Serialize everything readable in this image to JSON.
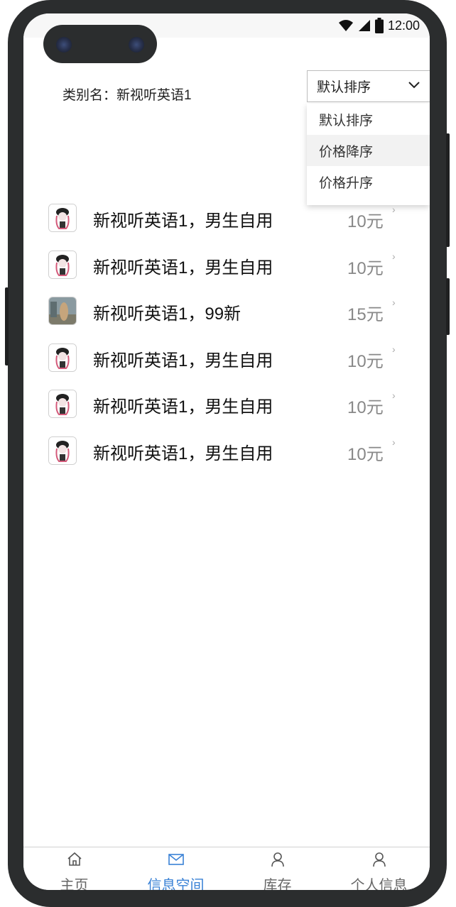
{
  "status_bar": {
    "time": "12:00"
  },
  "category": {
    "text": "类别名：新视听英语1"
  },
  "sort": {
    "selected": "默认排序",
    "options": [
      "默认排序",
      "价格降序",
      "价格升序"
    ],
    "highlighted_index": 1
  },
  "items": [
    {
      "title": "新视听英语1，男生自用",
      "price": "10元",
      "thumb_icon": "anime-girl-thumbnail"
    },
    {
      "title": "新视听英语1，男生自用",
      "price": "10元",
      "thumb_icon": "anime-girl-thumbnail"
    },
    {
      "title": "新视听英语1，99新",
      "price": "15元",
      "thumb_icon": "photo-thumbnail"
    },
    {
      "title": "新视听英语1，男生自用",
      "price": "10元",
      "thumb_icon": "anime-girl-thumbnail"
    },
    {
      "title": "新视听英语1，男生自用",
      "price": "10元",
      "thumb_icon": "anime-girl-thumbnail"
    },
    {
      "title": "新视听英语1，男生自用",
      "price": "10元",
      "thumb_icon": "anime-girl-thumbnail"
    }
  ],
  "arrow_glyph": "›",
  "tabs": [
    {
      "label": "主页",
      "icon": "home-icon",
      "active": false
    },
    {
      "label": "信息空间",
      "icon": "mail-icon",
      "active": true
    },
    {
      "label": "库存",
      "icon": "person-icon",
      "active": false
    },
    {
      "label": "个人信息",
      "icon": "person-icon",
      "active": false
    }
  ],
  "colors": {
    "accent": "#3a82d6",
    "price": "#888888",
    "frame": "#2b2d2e"
  }
}
